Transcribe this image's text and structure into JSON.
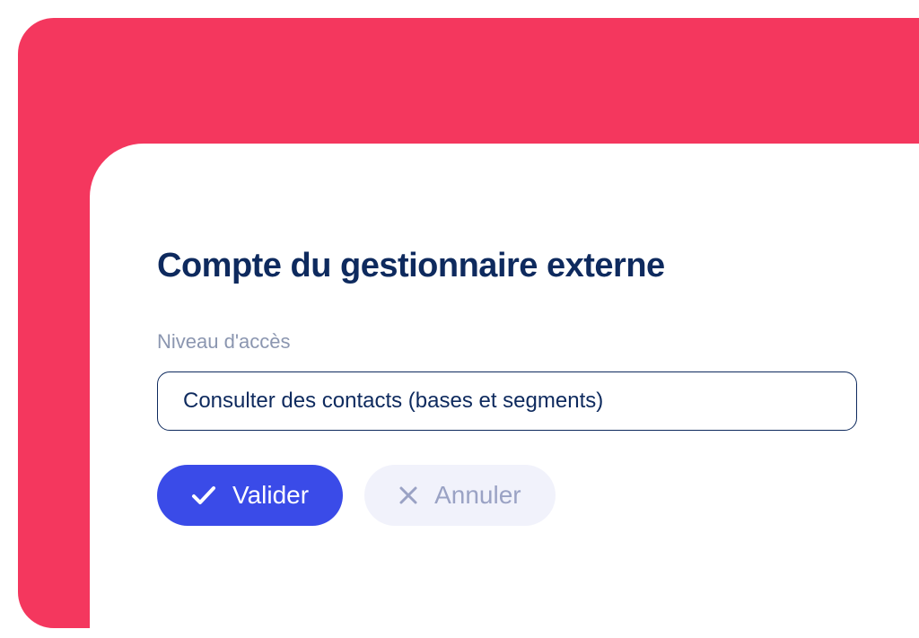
{
  "card": {
    "title": "Compte du gestionnaire externe",
    "field_label": "Niveau d'accès",
    "select_value": "Consulter des contacts (bases et segments)"
  },
  "buttons": {
    "validate_label": "Valider",
    "cancel_label": "Annuler"
  }
}
